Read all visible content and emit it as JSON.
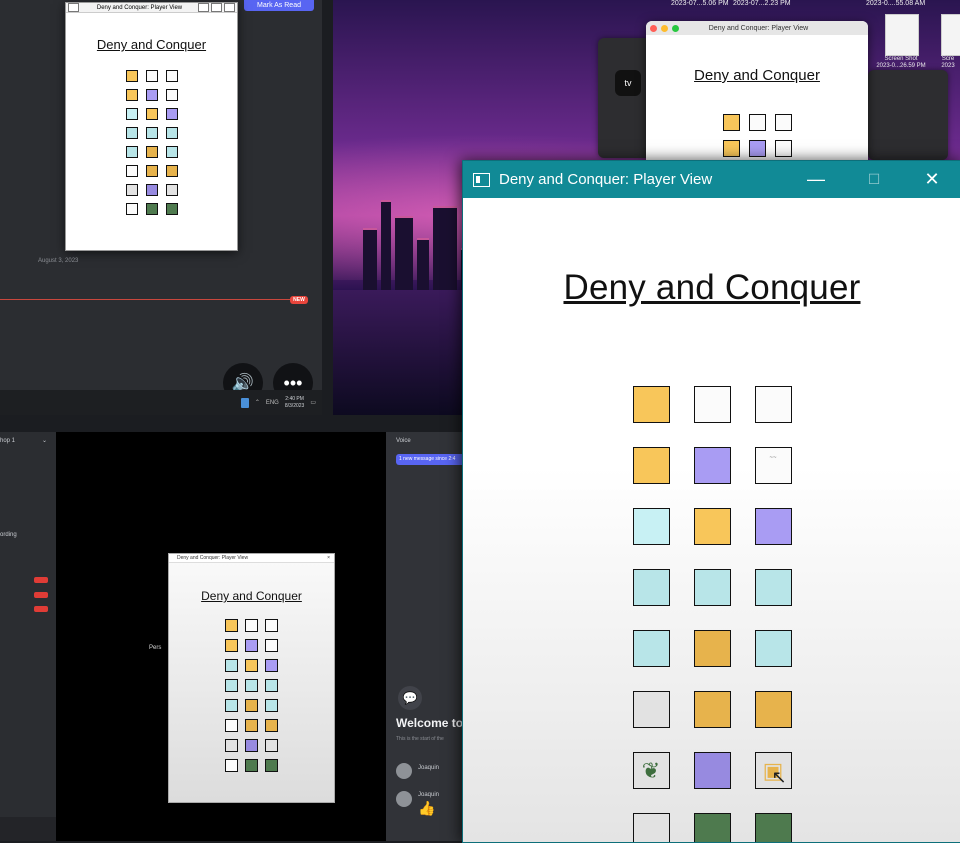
{
  "colors": {
    "orange": "#f8c65a",
    "orange_dark": "#e7b34c",
    "purple": "#a99cf3",
    "purple_dark": "#978ae0",
    "cyan": "#c8f1f4",
    "cyan_mid": "#b8e5e8",
    "white": "#fbfbfb",
    "light_gray": "#e2e2e2",
    "green": "#4e7a4e",
    "teal_titlebar": "#118a96",
    "discord_blurple": "#5865f2"
  },
  "main_window": {
    "title": "Deny and Conquer: Player View",
    "minimize_glyph": "—",
    "maximize_glyph": "☐",
    "close_glyph": "✕",
    "game_title": "Deny and Conquer",
    "grid": [
      [
        "orange",
        "white",
        "white"
      ],
      [
        "orange",
        "purple",
        "white-scribble"
      ],
      [
        "cyan",
        "orange",
        "purple"
      ],
      [
        "cyan_mid",
        "cyan_mid",
        "cyan_mid"
      ],
      [
        "cyan_mid",
        "orange_dark",
        "cyan_mid"
      ],
      [
        "light_gray",
        "orange_dark",
        "orange_dark"
      ],
      [
        "scribble-green",
        "purple_dark",
        "scribble-orange"
      ],
      [
        "light_gray",
        "green",
        "green"
      ]
    ]
  },
  "stream_top_left": {
    "mark_as_read": "Mark As Read",
    "date": "August 3, 2023",
    "new_badge": "NEW",
    "volume_icon": "🔊",
    "more_icon": "•••",
    "clock_time": "2:40 PM",
    "clock_date": "8/3/2023",
    "tray_text": "ENG",
    "window": {
      "title": "Deny and Conquer: Player View",
      "game_title": "Deny and Conquer",
      "grid": [
        [
          "orange",
          "white",
          "white"
        ],
        [
          "orange",
          "purple",
          "white"
        ],
        [
          "cyan",
          "orange",
          "purple"
        ],
        [
          "cyan_mid",
          "cyan_mid",
          "cyan_mid"
        ],
        [
          "cyan_mid",
          "orange_dark",
          "cyan_mid"
        ],
        [
          "white",
          "orange_dark",
          "orange_dark"
        ],
        [
          "scribble-gray",
          "purple_dark",
          "light_gray"
        ],
        [
          "white",
          "green",
          "green"
        ]
      ]
    }
  },
  "stream_top_right": {
    "screenshot_labels": [
      "2023-07...5.06 PM",
      "2023-07...2.23 PM",
      "2023-0....55.08 AM"
    ],
    "desktop_files": [
      {
        "label": "Screen Shot\n2023-0...26.59 PM"
      },
      {
        "label": "Scre\n2023"
      }
    ],
    "tv_label": "tv",
    "window": {
      "title": "Deny and Conquer: Player View",
      "game_title": "Deny and Conquer",
      "grid": [
        [
          "orange",
          "white",
          "white"
        ],
        [
          "orange",
          "purple",
          "white"
        ]
      ]
    }
  },
  "discord_left": {
    "channel": "hop 1",
    "item_recording": "ording",
    "live_badge": "LIVE"
  },
  "stream_bottom_middle": {
    "side_label": "Pers",
    "window": {
      "title": "Deny and Conquer: Player View",
      "game_title": "Deny and Conquer",
      "grid": [
        [
          "orange",
          "white",
          "white"
        ],
        [
          "orange",
          "purple",
          "white"
        ],
        [
          "cyan_mid",
          "orange",
          "purple"
        ],
        [
          "cyan_mid",
          "cyan_mid",
          "cyan_mid"
        ],
        [
          "cyan_mid",
          "orange_dark",
          "cyan_mid"
        ],
        [
          "white",
          "orange_dark",
          "orange_dark"
        ],
        [
          "scribble-gray",
          "purple_dark",
          "light_gray"
        ],
        [
          "white",
          "green",
          "green"
        ]
      ]
    }
  },
  "discord_chat": {
    "channel": "Voice",
    "new_messages": "1 new message since 2:4",
    "welcome": "Welcome to",
    "start_text": "This is the start of the",
    "user1": "Joaquin",
    "user2": "Joaquin",
    "thumbs": "👍"
  }
}
